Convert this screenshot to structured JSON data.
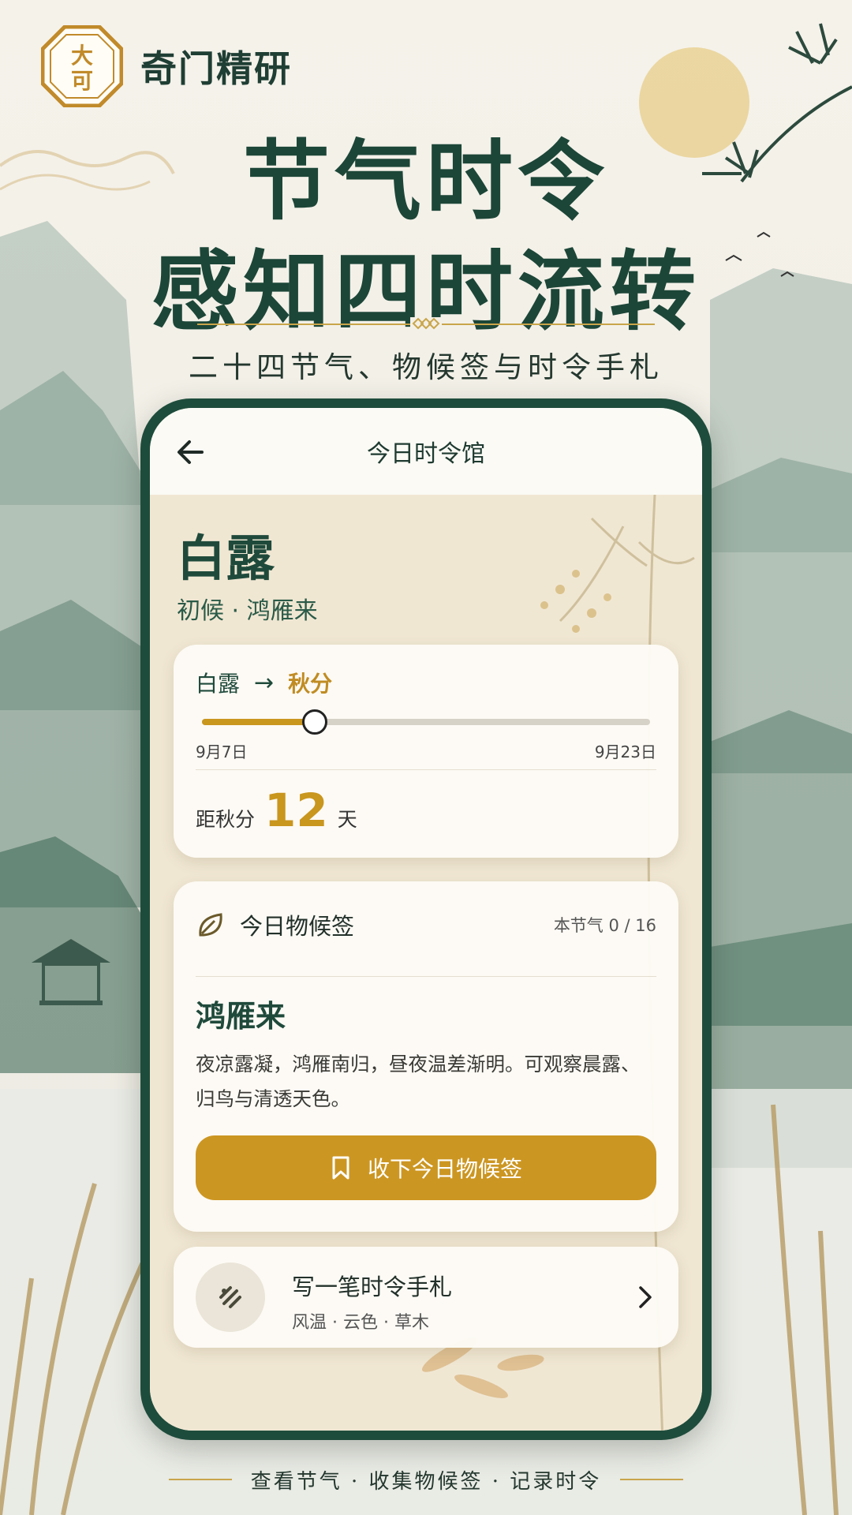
{
  "brand": {
    "name": "奇门精研",
    "seal_chars": "大可"
  },
  "headline": {
    "line1": "节气时令",
    "line2": "感知四时流转"
  },
  "subtitle": "二十四节气、物候签与时令手札",
  "app": {
    "title": "今日时令馆",
    "term": {
      "name": "白露",
      "phase": "初候 · 鸿雁来"
    },
    "progress": {
      "from": "白露",
      "arrow": "→",
      "to": "秋分",
      "start_date": "9月7日",
      "end_date": "9月23日",
      "fraction": 0.25,
      "countdown_label": "距秋分",
      "countdown_value": "12",
      "countdown_unit": "天"
    },
    "phenology_card": {
      "title": "今日物候签",
      "count": "本节气 0 / 16",
      "name": "鸿雁来",
      "description": "夜凉露凝，鸿雁南归，昼夜温差渐明。可观察晨露、归鸟与清透天色。",
      "button": "收下今日物候签"
    },
    "journal_card": {
      "title": "写一笔时令手札",
      "tags": "风温 · 云色 · 草木"
    }
  },
  "footer": "查看节气 · 收集物候签 · 记录时令",
  "colors": {
    "primary_green": "#1f4a3b",
    "gold": "#c9961e",
    "button_gold": "#cc9622",
    "paper": "#f3f0e7"
  },
  "icons": [
    "seal-logo-icon",
    "back-arrow-icon",
    "leaf-icon",
    "bookmark-icon",
    "pen-swirl-icon",
    "chevron-right-icon"
  ]
}
